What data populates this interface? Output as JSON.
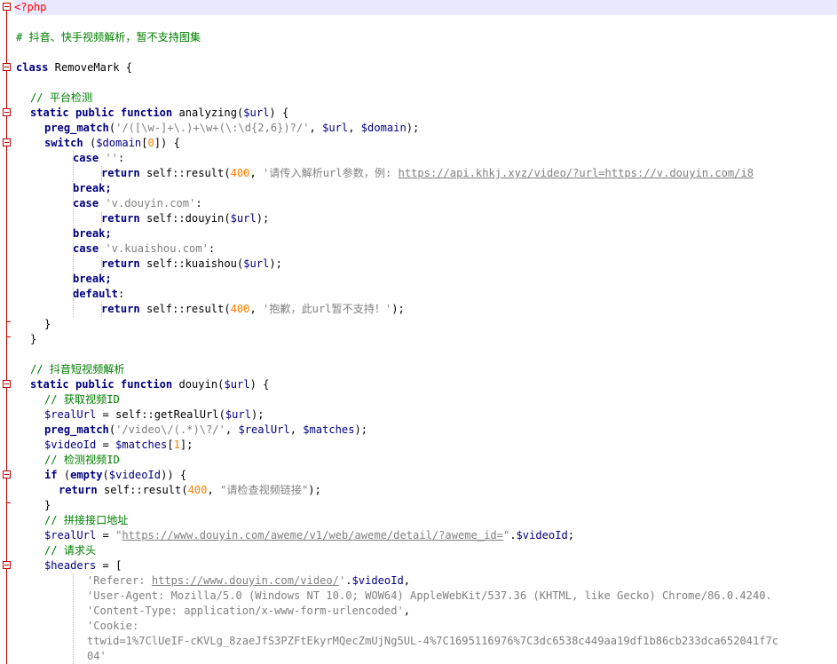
{
  "editor": {
    "lines": [
      {
        "tokens": [
          [
            "php",
            "<?php"
          ]
        ],
        "indent": 0,
        "hl": true
      },
      {
        "tokens": [],
        "indent": 0
      },
      {
        "tokens": [
          [
            "cm",
            "# 抖音、快手视频解析，暂不支持图集"
          ]
        ],
        "indent": 0
      },
      {
        "tokens": [],
        "indent": 0
      },
      {
        "tokens": [
          [
            "kw",
            "class"
          ],
          [
            "fn",
            " RemoveMark "
          ],
          [
            "fn",
            "{"
          ]
        ],
        "indent": 0
      },
      {
        "tokens": [],
        "indent": 0
      },
      {
        "tokens": [
          [
            "cm",
            "// 平台检测"
          ]
        ],
        "indent": 2
      },
      {
        "tokens": [
          [
            "kw",
            "static public function"
          ],
          [
            "fn",
            " analyzing("
          ],
          [
            "var",
            "$url"
          ],
          [
            "fn",
            ") {"
          ]
        ],
        "indent": 2
      },
      {
        "tokens": [
          [
            "kw",
            "preg_match"
          ],
          [
            "fn",
            "("
          ],
          [
            "str",
            "'/([\\w-]+\\.)+\\w+(\\:\\d{2,6})?/'"
          ],
          [
            "fn",
            ", "
          ],
          [
            "var",
            "$url"
          ],
          [
            "fn",
            ", "
          ],
          [
            "var",
            "$domain"
          ],
          [
            "fn",
            ");"
          ]
        ],
        "indent": 4
      },
      {
        "tokens": [
          [
            "kw",
            "switch"
          ],
          [
            "fn",
            " ("
          ],
          [
            "var",
            "$domain"
          ],
          [
            "fn",
            "["
          ],
          [
            "num",
            "0"
          ],
          [
            "fn",
            "]) {"
          ]
        ],
        "indent": 4
      },
      {
        "tokens": [
          [
            "kw",
            "case"
          ],
          [
            "fn",
            " "
          ],
          [
            "str",
            "''"
          ],
          [
            "fn",
            ":"
          ]
        ],
        "indent": 8
      },
      {
        "tokens": [
          [
            "kw",
            "return"
          ],
          [
            "fn",
            " self::result("
          ],
          [
            "num",
            "400"
          ],
          [
            "fn",
            ", "
          ],
          [
            "str",
            "'请传入解析url参数，例: "
          ],
          [
            "url",
            "https://api.khkj.xyz/video/?url=https://v.douyin.com/i8"
          ]
        ],
        "indent": 12
      },
      {
        "tokens": [
          [
            "kw",
            "break;"
          ]
        ],
        "indent": 8
      },
      {
        "tokens": [
          [
            "kw",
            "case"
          ],
          [
            "fn",
            " "
          ],
          [
            "str",
            "'v.douyin.com'"
          ],
          [
            "fn",
            ":"
          ]
        ],
        "indent": 8
      },
      {
        "tokens": [
          [
            "kw",
            "return"
          ],
          [
            "fn",
            " self::douyin("
          ],
          [
            "var",
            "$url"
          ],
          [
            "fn",
            ");"
          ]
        ],
        "indent": 12
      },
      {
        "tokens": [
          [
            "kw",
            "break;"
          ]
        ],
        "indent": 8
      },
      {
        "tokens": [
          [
            "kw",
            "case"
          ],
          [
            "fn",
            " "
          ],
          [
            "str",
            "'v.kuaishou.com'"
          ],
          [
            "fn",
            ":"
          ]
        ],
        "indent": 8
      },
      {
        "tokens": [
          [
            "kw",
            "return"
          ],
          [
            "fn",
            " self::kuaishou("
          ],
          [
            "var",
            "$url"
          ],
          [
            "fn",
            ");"
          ]
        ],
        "indent": 12
      },
      {
        "tokens": [
          [
            "kw",
            "break;"
          ]
        ],
        "indent": 8
      },
      {
        "tokens": [
          [
            "kw",
            "default"
          ],
          [
            "fn",
            ":"
          ]
        ],
        "indent": 8
      },
      {
        "tokens": [
          [
            "kw",
            "return"
          ],
          [
            "fn",
            " self::result("
          ],
          [
            "num",
            "400"
          ],
          [
            "fn",
            ", "
          ],
          [
            "str",
            "'抱歉，此url暂不支持！'"
          ],
          [
            "fn",
            ");"
          ]
        ],
        "indent": 12
      },
      {
        "tokens": [
          [
            "fn",
            "}"
          ]
        ],
        "indent": 4
      },
      {
        "tokens": [
          [
            "fn",
            "}"
          ]
        ],
        "indent": 2
      },
      {
        "tokens": [],
        "indent": 0
      },
      {
        "tokens": [
          [
            "cm",
            "// 抖音短视频解析"
          ]
        ],
        "indent": 2
      },
      {
        "tokens": [
          [
            "kw",
            "static public function"
          ],
          [
            "fn",
            " douyin("
          ],
          [
            "var",
            "$url"
          ],
          [
            "fn",
            ") {"
          ]
        ],
        "indent": 2
      },
      {
        "tokens": [
          [
            "cm",
            "// 获取视频ID"
          ]
        ],
        "indent": 4
      },
      {
        "tokens": [
          [
            "var",
            "$realUrl"
          ],
          [
            "fn",
            " = self::getRealUrl("
          ],
          [
            "var",
            "$url"
          ],
          [
            "fn",
            ");"
          ]
        ],
        "indent": 4
      },
      {
        "tokens": [
          [
            "kw",
            "preg_match"
          ],
          [
            "fn",
            "("
          ],
          [
            "str",
            "'/video\\/(.*)\\?/'"
          ],
          [
            "fn",
            ", "
          ],
          [
            "var",
            "$realUrl"
          ],
          [
            "fn",
            ", "
          ],
          [
            "var",
            "$matches"
          ],
          [
            "fn",
            ");"
          ]
        ],
        "indent": 4
      },
      {
        "tokens": [
          [
            "var",
            "$videoId"
          ],
          [
            "fn",
            " = "
          ],
          [
            "var",
            "$matches"
          ],
          [
            "fn",
            "["
          ],
          [
            "num",
            "1"
          ],
          [
            "fn",
            "];"
          ]
        ],
        "indent": 4
      },
      {
        "tokens": [
          [
            "cm",
            "// 检测视频ID"
          ]
        ],
        "indent": 4
      },
      {
        "tokens": [
          [
            "kw",
            "if"
          ],
          [
            "fn",
            " ("
          ],
          [
            "kw",
            "empty"
          ],
          [
            "fn",
            "("
          ],
          [
            "var",
            "$videoId"
          ],
          [
            "fn",
            ")) {"
          ]
        ],
        "indent": 4
      },
      {
        "tokens": [
          [
            "kw",
            "return"
          ],
          [
            "fn",
            " self::result("
          ],
          [
            "num",
            "400"
          ],
          [
            "fn",
            ", "
          ],
          [
            "str",
            "\"请检查视频链接\""
          ],
          [
            "fn",
            ");"
          ]
        ],
        "indent": 6
      },
      {
        "tokens": [
          [
            "fn",
            "}"
          ]
        ],
        "indent": 4
      },
      {
        "tokens": [
          [
            "cm",
            "// 拼接接口地址"
          ]
        ],
        "indent": 4
      },
      {
        "tokens": [
          [
            "var",
            "$realUrl"
          ],
          [
            "fn",
            " = "
          ],
          [
            "str",
            "\""
          ],
          [
            "url",
            "https://www.douyin.com/aweme/v1/web/aweme/detail/?aweme_id="
          ],
          [
            "str",
            "\""
          ],
          [
            "fn",
            "."
          ],
          [
            "var",
            "$videoId"
          ],
          [
            "fn",
            ";"
          ]
        ],
        "indent": 4
      },
      {
        "tokens": [
          [
            "cm",
            "// 请求头"
          ]
        ],
        "indent": 4
      },
      {
        "tokens": [
          [
            "var",
            "$headers"
          ],
          [
            "fn",
            " = ["
          ]
        ],
        "indent": 4
      },
      {
        "tokens": [
          [
            "str",
            "'Referer: "
          ],
          [
            "url",
            "https://www.douyin.com/video/"
          ],
          [
            "str",
            "'"
          ],
          [
            "fn",
            "."
          ],
          [
            "var",
            "$videoId"
          ],
          [
            "fn",
            ","
          ]
        ],
        "indent": 10
      },
      {
        "tokens": [
          [
            "str",
            "'User-Agent: Mozilla/5.0 (Windows NT 10.0; WOW64) AppleWebKit/537.36 (KHTML, like Gecko) Chrome/86.0.4240."
          ]
        ],
        "indent": 10
      },
      {
        "tokens": [
          [
            "str",
            "'Content-Type: application/x-www-form-urlencoded'"
          ],
          [
            "fn",
            ","
          ]
        ],
        "indent": 10
      },
      {
        "tokens": [
          [
            "str",
            "'Cookie:"
          ]
        ],
        "indent": 10
      },
      {
        "tokens": [
          [
            "str",
            "ttwid=1%7ClUeIF-cKVLg_8zaeJfS3PZFtEkyrMQecZmUjNg5UL-4%7C1695116976%7C3dc6538c449aa19df1b86cb233dca652041f7c"
          ]
        ],
        "indent": 10
      },
      {
        "tokens": [
          [
            "str",
            "04'"
          ]
        ],
        "indent": 10
      }
    ]
  }
}
